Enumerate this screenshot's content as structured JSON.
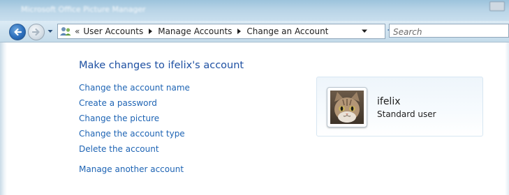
{
  "window": {
    "title": "Microsoft Office Picture Manager"
  },
  "navigation": {
    "breadcrumb": [
      "User Accounts",
      "Manage Accounts",
      "Change an Account"
    ],
    "search_placeholder": "Search"
  },
  "main": {
    "title": "Make changes to ifelix's account",
    "tasks": [
      "Change the account name",
      "Create a password",
      "Change the picture",
      "Change the account type",
      "Delete the account"
    ],
    "other_task": "Manage another account"
  },
  "account": {
    "name": "ifelix",
    "type": "Standard user",
    "picture_icon": "kitten-photo"
  },
  "colors": {
    "link": "#1e64b4",
    "title": "#1e50a2"
  }
}
